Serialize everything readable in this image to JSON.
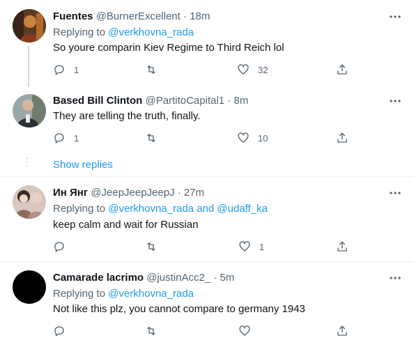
{
  "colors": {
    "accent": "#1d9bf0",
    "text": "#0f1419",
    "muted": "#536471",
    "border": "#eff3f4"
  },
  "tweets": [
    {
      "name": "Fuentes",
      "handle": "@BurnerExcellent",
      "time": "· 18m",
      "replying_prefix": "Replying to",
      "mentions": [
        "@verkhovna_rada"
      ],
      "text": "So youre comparin Kiev Regime to Third Reich lol",
      "reply_count": "1",
      "retweet_count": "",
      "like_count": "32"
    },
    {
      "name": "Based Bill Clinton",
      "handle": "@PartitoCapital1",
      "time": "· 8m",
      "text": "They are telling the truth, finally.",
      "reply_count": "1",
      "retweet_count": "",
      "like_count": "10",
      "show_replies": "Show replies"
    },
    {
      "name": "Ин Янг",
      "handle": "@JeepJeepJeepJ",
      "time": "· 27m",
      "replying_prefix": "Replying to",
      "mentions": [
        "@verkhovna_rada",
        "@udaff_ka"
      ],
      "mention_joiner": "and",
      "text": "keep calm and wait for Russian",
      "reply_count": "",
      "retweet_count": "",
      "like_count": "1"
    },
    {
      "name": "Camarade lacrimo",
      "handle": "@justinAcc2_",
      "time": "· 5m",
      "replying_prefix": "Replying to",
      "mentions": [
        "@verkhovna_rada"
      ],
      "text": "Not like this plz, you cannot compare to germany 1943",
      "reply_count": "",
      "retweet_count": "",
      "like_count": ""
    }
  ],
  "icons": {
    "reply": "reply-icon",
    "retweet": "retweet-icon",
    "like": "heart-icon",
    "share": "share-icon",
    "more": "more-icon"
  }
}
